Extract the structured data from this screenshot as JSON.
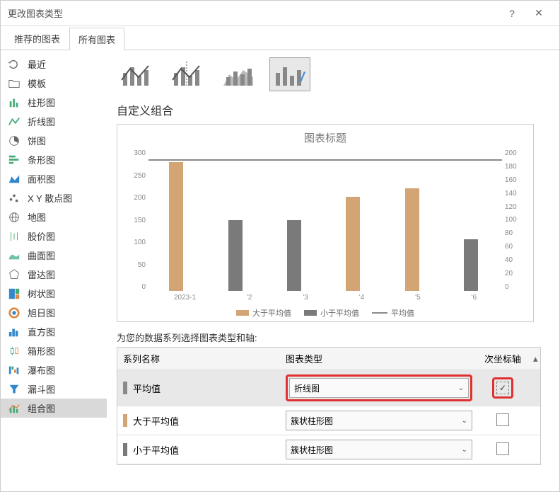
{
  "window": {
    "title": "更改图表类型"
  },
  "tabs": {
    "recommended": "推荐的图表",
    "all": "所有图表"
  },
  "sidebar": {
    "items": [
      {
        "label": "最近"
      },
      {
        "label": "模板"
      },
      {
        "label": "柱形图"
      },
      {
        "label": "折线图"
      },
      {
        "label": "饼图"
      },
      {
        "label": "条形图"
      },
      {
        "label": "面积图"
      },
      {
        "label": "X Y 散点图"
      },
      {
        "label": "地图"
      },
      {
        "label": "股价图"
      },
      {
        "label": "曲面图"
      },
      {
        "label": "雷达图"
      },
      {
        "label": "树状图"
      },
      {
        "label": "旭日图"
      },
      {
        "label": "直方图"
      },
      {
        "label": "箱形图"
      },
      {
        "label": "瀑布图"
      },
      {
        "label": "漏斗图"
      },
      {
        "label": "组合图"
      }
    ]
  },
  "content": {
    "section_title": "自定义组合",
    "series_prompt": "为您的数据系列选择图表类型和轴:",
    "table": {
      "col_name": "系列名称",
      "col_type": "图表类型",
      "col_axis": "次坐标轴",
      "rows": [
        {
          "name": "平均值",
          "type": "折线图",
          "axis_checked": true,
          "swatch": "sw-line",
          "highlighted": true
        },
        {
          "name": "大于平均值",
          "type": "簇状柱形图",
          "axis_checked": false,
          "swatch": "sw-orange",
          "highlighted": false
        },
        {
          "name": "小于平均值",
          "type": "簇状柱形图",
          "axis_checked": false,
          "swatch": "sw-gray",
          "highlighted": false
        }
      ]
    }
  },
  "chart_data": {
    "type": "bar",
    "title": "图表标题",
    "categories": [
      "2023-1",
      "'2",
      "'3",
      "'4",
      "'5",
      "'6"
    ],
    "y_left": {
      "min": 0,
      "max": 300,
      "ticks": [
        0,
        50,
        100,
        150,
        200,
        250,
        300
      ]
    },
    "y_right": {
      "min": 0,
      "max": 200,
      "ticks": [
        0,
        20,
        40,
        60,
        80,
        100,
        120,
        140,
        160,
        180,
        200
      ]
    },
    "series": [
      {
        "name": "大于平均值",
        "color": "orange",
        "values": [
          273,
          null,
          null,
          200,
          218,
          null
        ]
      },
      {
        "name": "小于平均值",
        "color": "gray",
        "values": [
          null,
          150,
          150,
          null,
          null,
          110
        ]
      },
      {
        "name": "平均值",
        "type": "line",
        "value": 184
      }
    ],
    "legend": {
      "gt": "大于平均值",
      "lt": "小于平均值",
      "avg": "平均值"
    }
  }
}
